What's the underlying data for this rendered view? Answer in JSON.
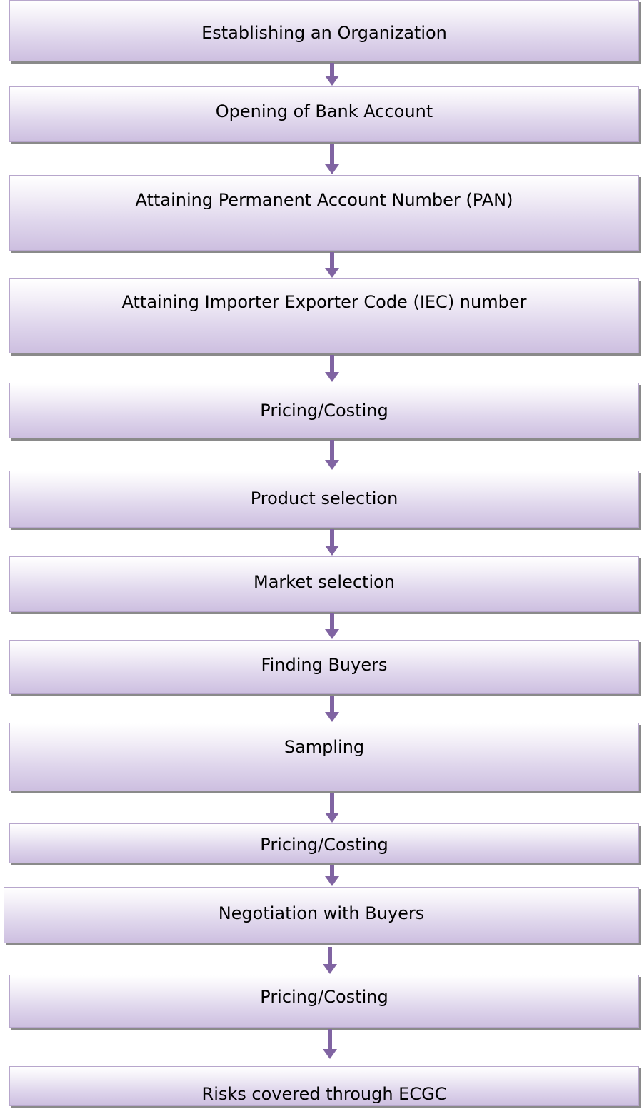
{
  "flowchart": {
    "steps": [
      {
        "label": "Establishing an Organization"
      },
      {
        "label": "Opening of Bank Account"
      },
      {
        "label": "Attaining Permanent Account Number (PAN)"
      },
      {
        "label": "Attaining Importer Exporter Code (IEC) number"
      },
      {
        "label": "Pricing/Costing"
      },
      {
        "label": "Product selection"
      },
      {
        "label": "Market selection"
      },
      {
        "label": "Finding Buyers"
      },
      {
        "label": "Sampling"
      },
      {
        "label": "Pricing/Costing"
      },
      {
        "label": "Negotiation with Buyers"
      },
      {
        "label": "Pricing/Costing"
      },
      {
        "label": "Risks covered through ECGC"
      }
    ],
    "colors": {
      "arrow": "#8064a2",
      "box_border": "#b7a6cc",
      "box_gradient_top": "#ffffff",
      "box_gradient_bottom": "#cdbfe0",
      "shadow": "#8a8a8a"
    }
  }
}
